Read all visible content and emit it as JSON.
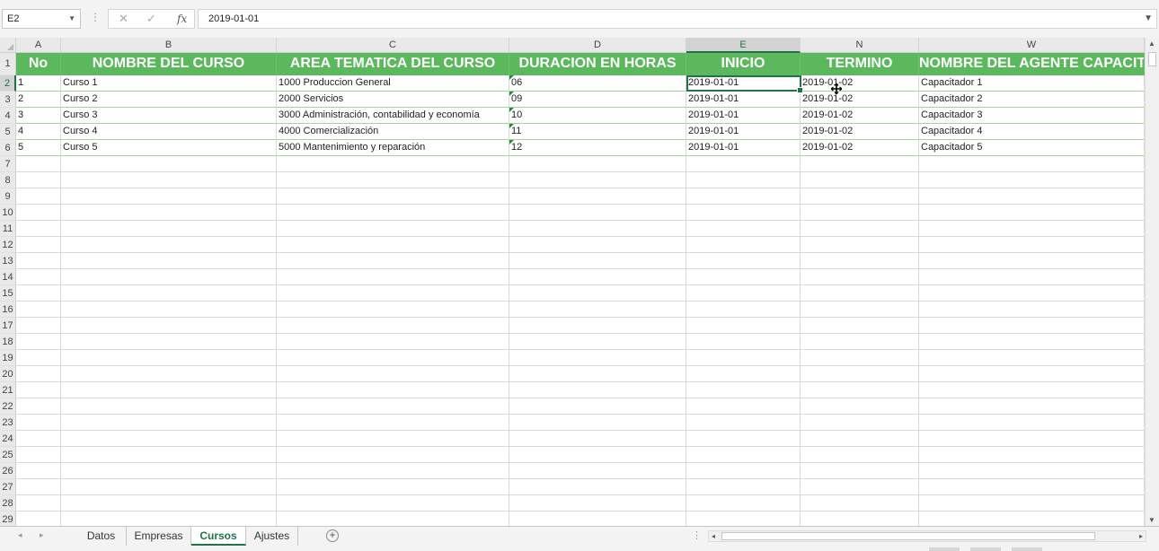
{
  "formula_bar": {
    "name_box": "E2",
    "dots": "⋮",
    "cancel_icon": "✕",
    "enter_icon": "✓",
    "fx_label": "fx",
    "value": "2019-01-01"
  },
  "columns": [
    "A",
    "B",
    "C",
    "D",
    "E",
    "N",
    "W"
  ],
  "selected_column": "E",
  "rows": [
    "1",
    "2",
    "3",
    "4",
    "5",
    "6",
    "7",
    "8",
    "9",
    "10",
    "11",
    "12",
    "13",
    "14",
    "15",
    "16",
    "17",
    "18",
    "19",
    "20",
    "21",
    "22",
    "23",
    "24",
    "25",
    "26",
    "27",
    "28",
    "29"
  ],
  "selected_row": "2",
  "table": {
    "headers": [
      "No",
      "NOMBRE DEL CURSO",
      "AREA TEMATICA DEL CURSO",
      "DURACION EN HORAS",
      "INICIO",
      "TERMINO",
      "NOMBRE DEL AGENTE CAPACITADOR"
    ],
    "rows": [
      [
        "1",
        "Curso 1",
        "1000 Produccion General",
        "06",
        "2019-01-01",
        "2019-01-02",
        "Capacitador 1"
      ],
      [
        "2",
        "Curso 2",
        "2000 Servicios",
        "09",
        "2019-01-01",
        "2019-01-02",
        "Capacitador 2"
      ],
      [
        "3",
        "Curso 3",
        "3000 Administración, contabilidad y economía",
        "10",
        "2019-01-01",
        "2019-01-02",
        "Capacitador 3"
      ],
      [
        "4",
        "Curso 4",
        "4000 Comercialización",
        "11",
        "2019-01-01",
        "2019-01-02",
        "Capacitador 4"
      ],
      [
        "5",
        "Curso 5",
        "5000 Mantenimiento y reparación",
        "12",
        "2019-01-01",
        "2019-01-02",
        "Capacitador 5"
      ]
    ]
  },
  "sheets": {
    "tabs": [
      "Datos",
      "Empresas",
      "Cursos",
      "Ajustes"
    ],
    "active": "Cursos",
    "add_label": "+",
    "nav_prev": "◂",
    "nav_next": "▸"
  },
  "colors": {
    "header_green": "#5cb85c",
    "accent": "#217346"
  },
  "icons": {
    "cursor": "move-cursor-icon"
  }
}
